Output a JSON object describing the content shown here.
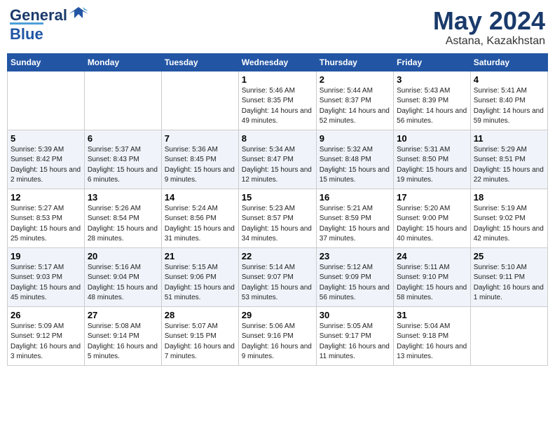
{
  "logo": {
    "line1": "General",
    "line2": "Blue"
  },
  "title": "May 2024",
  "location": "Astana, Kazakhstan",
  "days_header": [
    "Sunday",
    "Monday",
    "Tuesday",
    "Wednesday",
    "Thursday",
    "Friday",
    "Saturday"
  ],
  "weeks": [
    [
      {
        "day": "",
        "sunrise": "",
        "sunset": "",
        "daylight": ""
      },
      {
        "day": "",
        "sunrise": "",
        "sunset": "",
        "daylight": ""
      },
      {
        "day": "",
        "sunrise": "",
        "sunset": "",
        "daylight": ""
      },
      {
        "day": "1",
        "sunrise": "Sunrise: 5:46 AM",
        "sunset": "Sunset: 8:35 PM",
        "daylight": "Daylight: 14 hours and 49 minutes."
      },
      {
        "day": "2",
        "sunrise": "Sunrise: 5:44 AM",
        "sunset": "Sunset: 8:37 PM",
        "daylight": "Daylight: 14 hours and 52 minutes."
      },
      {
        "day": "3",
        "sunrise": "Sunrise: 5:43 AM",
        "sunset": "Sunset: 8:39 PM",
        "daylight": "Daylight: 14 hours and 56 minutes."
      },
      {
        "day": "4",
        "sunrise": "Sunrise: 5:41 AM",
        "sunset": "Sunset: 8:40 PM",
        "daylight": "Daylight: 14 hours and 59 minutes."
      }
    ],
    [
      {
        "day": "5",
        "sunrise": "Sunrise: 5:39 AM",
        "sunset": "Sunset: 8:42 PM",
        "daylight": "Daylight: 15 hours and 2 minutes."
      },
      {
        "day": "6",
        "sunrise": "Sunrise: 5:37 AM",
        "sunset": "Sunset: 8:43 PM",
        "daylight": "Daylight: 15 hours and 6 minutes."
      },
      {
        "day": "7",
        "sunrise": "Sunrise: 5:36 AM",
        "sunset": "Sunset: 8:45 PM",
        "daylight": "Daylight: 15 hours and 9 minutes."
      },
      {
        "day": "8",
        "sunrise": "Sunrise: 5:34 AM",
        "sunset": "Sunset: 8:47 PM",
        "daylight": "Daylight: 15 hours and 12 minutes."
      },
      {
        "day": "9",
        "sunrise": "Sunrise: 5:32 AM",
        "sunset": "Sunset: 8:48 PM",
        "daylight": "Daylight: 15 hours and 15 minutes."
      },
      {
        "day": "10",
        "sunrise": "Sunrise: 5:31 AM",
        "sunset": "Sunset: 8:50 PM",
        "daylight": "Daylight: 15 hours and 19 minutes."
      },
      {
        "day": "11",
        "sunrise": "Sunrise: 5:29 AM",
        "sunset": "Sunset: 8:51 PM",
        "daylight": "Daylight: 15 hours and 22 minutes."
      }
    ],
    [
      {
        "day": "12",
        "sunrise": "Sunrise: 5:27 AM",
        "sunset": "Sunset: 8:53 PM",
        "daylight": "Daylight: 15 hours and 25 minutes."
      },
      {
        "day": "13",
        "sunrise": "Sunrise: 5:26 AM",
        "sunset": "Sunset: 8:54 PM",
        "daylight": "Daylight: 15 hours and 28 minutes."
      },
      {
        "day": "14",
        "sunrise": "Sunrise: 5:24 AM",
        "sunset": "Sunset: 8:56 PM",
        "daylight": "Daylight: 15 hours and 31 minutes."
      },
      {
        "day": "15",
        "sunrise": "Sunrise: 5:23 AM",
        "sunset": "Sunset: 8:57 PM",
        "daylight": "Daylight: 15 hours and 34 minutes."
      },
      {
        "day": "16",
        "sunrise": "Sunrise: 5:21 AM",
        "sunset": "Sunset: 8:59 PM",
        "daylight": "Daylight: 15 hours and 37 minutes."
      },
      {
        "day": "17",
        "sunrise": "Sunrise: 5:20 AM",
        "sunset": "Sunset: 9:00 PM",
        "daylight": "Daylight: 15 hours and 40 minutes."
      },
      {
        "day": "18",
        "sunrise": "Sunrise: 5:19 AM",
        "sunset": "Sunset: 9:02 PM",
        "daylight": "Daylight: 15 hours and 42 minutes."
      }
    ],
    [
      {
        "day": "19",
        "sunrise": "Sunrise: 5:17 AM",
        "sunset": "Sunset: 9:03 PM",
        "daylight": "Daylight: 15 hours and 45 minutes."
      },
      {
        "day": "20",
        "sunrise": "Sunrise: 5:16 AM",
        "sunset": "Sunset: 9:04 PM",
        "daylight": "Daylight: 15 hours and 48 minutes."
      },
      {
        "day": "21",
        "sunrise": "Sunrise: 5:15 AM",
        "sunset": "Sunset: 9:06 PM",
        "daylight": "Daylight: 15 hours and 51 minutes."
      },
      {
        "day": "22",
        "sunrise": "Sunrise: 5:14 AM",
        "sunset": "Sunset: 9:07 PM",
        "daylight": "Daylight: 15 hours and 53 minutes."
      },
      {
        "day": "23",
        "sunrise": "Sunrise: 5:12 AM",
        "sunset": "Sunset: 9:09 PM",
        "daylight": "Daylight: 15 hours and 56 minutes."
      },
      {
        "day": "24",
        "sunrise": "Sunrise: 5:11 AM",
        "sunset": "Sunset: 9:10 PM",
        "daylight": "Daylight: 15 hours and 58 minutes."
      },
      {
        "day": "25",
        "sunrise": "Sunrise: 5:10 AM",
        "sunset": "Sunset: 9:11 PM",
        "daylight": "Daylight: 16 hours and 1 minute."
      }
    ],
    [
      {
        "day": "26",
        "sunrise": "Sunrise: 5:09 AM",
        "sunset": "Sunset: 9:12 PM",
        "daylight": "Daylight: 16 hours and 3 minutes."
      },
      {
        "day": "27",
        "sunrise": "Sunrise: 5:08 AM",
        "sunset": "Sunset: 9:14 PM",
        "daylight": "Daylight: 16 hours and 5 minutes."
      },
      {
        "day": "28",
        "sunrise": "Sunrise: 5:07 AM",
        "sunset": "Sunset: 9:15 PM",
        "daylight": "Daylight: 16 hours and 7 minutes."
      },
      {
        "day": "29",
        "sunrise": "Sunrise: 5:06 AM",
        "sunset": "Sunset: 9:16 PM",
        "daylight": "Daylight: 16 hours and 9 minutes."
      },
      {
        "day": "30",
        "sunrise": "Sunrise: 5:05 AM",
        "sunset": "Sunset: 9:17 PM",
        "daylight": "Daylight: 16 hours and 11 minutes."
      },
      {
        "day": "31",
        "sunrise": "Sunrise: 5:04 AM",
        "sunset": "Sunset: 9:18 PM",
        "daylight": "Daylight: 16 hours and 13 minutes."
      },
      {
        "day": "",
        "sunrise": "",
        "sunset": "",
        "daylight": ""
      }
    ]
  ]
}
